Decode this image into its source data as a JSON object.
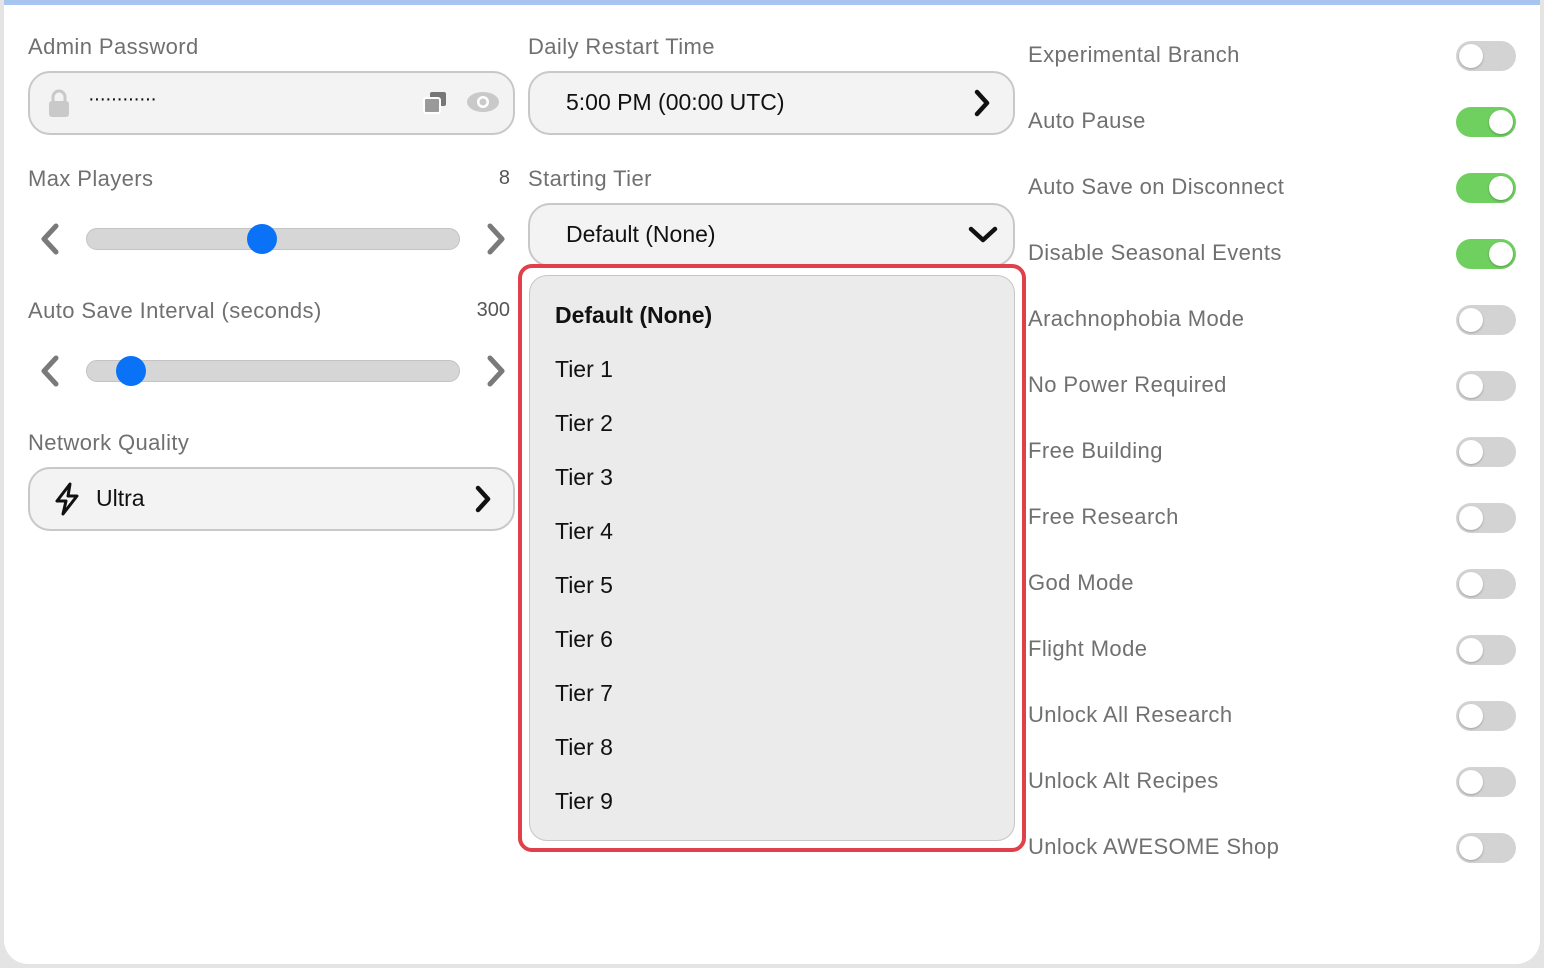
{
  "colors": {
    "accent": "#0a72f7",
    "toggle_on": "#6fcf5f",
    "toggle_off": "#d3d3d3",
    "highlight_border": "#e04049"
  },
  "admin_password": {
    "label": "Admin Password",
    "value": "············",
    "icons": [
      "lock-icon",
      "copy-icon",
      "eye-icon"
    ]
  },
  "daily_restart": {
    "label": "Daily Restart Time",
    "value": "5:00 PM (00:00 UTC)"
  },
  "max_players": {
    "label": "Max Players",
    "value": "8",
    "slider_fraction": 0.47
  },
  "auto_save_interval": {
    "label": "Auto Save Interval (seconds)",
    "value": "300",
    "slider_fraction": 0.12
  },
  "network_quality": {
    "label": "Network Quality",
    "value": "Ultra"
  },
  "starting_tier": {
    "label": "Starting Tier",
    "selected": "Default (None)",
    "options": [
      "Default (None)",
      "Tier 1",
      "Tier 2",
      "Tier 3",
      "Tier 4",
      "Tier 5",
      "Tier 6",
      "Tier 7",
      "Tier 8",
      "Tier 9"
    ]
  },
  "toggles": [
    {
      "label": "Experimental Branch",
      "on": false
    },
    {
      "label": "Auto Pause",
      "on": true
    },
    {
      "label": "Auto Save on Disconnect",
      "on": true
    },
    {
      "label": "Disable Seasonal Events",
      "on": true
    },
    {
      "label": "Arachnophobia Mode",
      "on": false
    },
    {
      "label": "No Power Required",
      "on": false
    },
    {
      "label": "Free Building",
      "on": false
    },
    {
      "label": "Free Research",
      "on": false
    },
    {
      "label": "God Mode",
      "on": false
    },
    {
      "label": "Flight Mode",
      "on": false
    },
    {
      "label": "Unlock All Research",
      "on": false
    },
    {
      "label": "Unlock Alt Recipes",
      "on": false
    },
    {
      "label": "Unlock AWESOME Shop",
      "on": false
    }
  ]
}
